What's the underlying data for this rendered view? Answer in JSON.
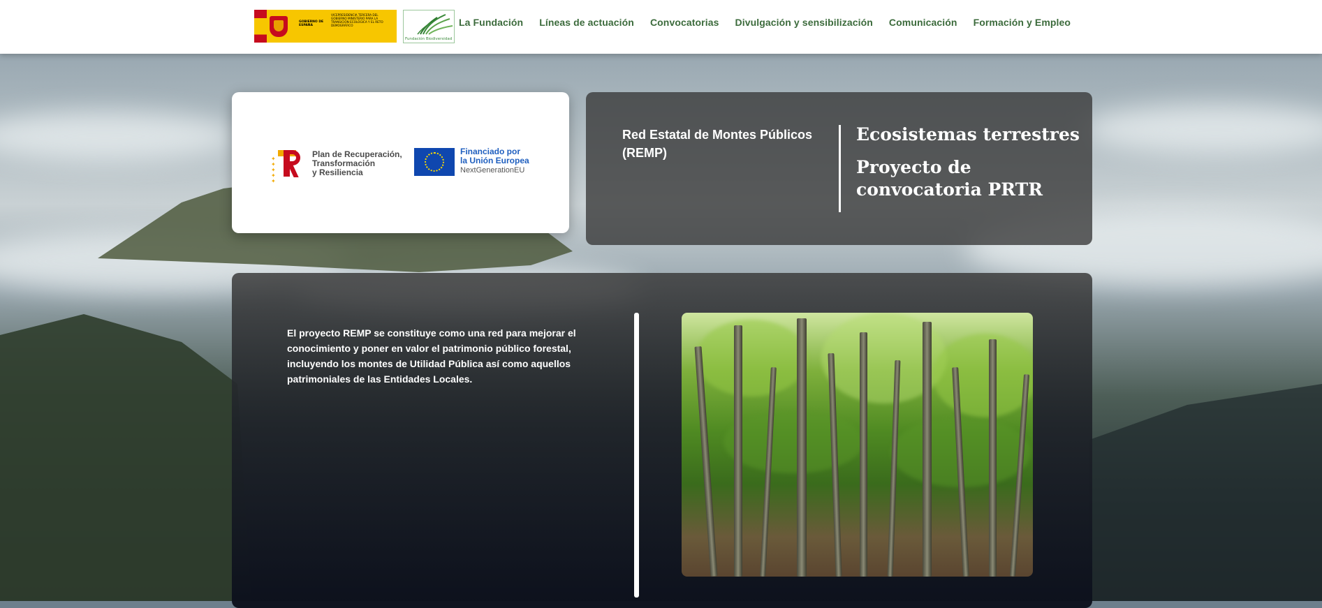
{
  "header": {
    "gov_logo": {
      "line1": "GOBIERNO DE ESPAÑA",
      "line2": "VICEPRESIDENCIA TERCERA DEL GOBIERNO MINISTERIO PARA LA TRANSICIÓN ECOLÓGICA Y EL RETO DEMOGRÁFICO"
    },
    "fb_logo_text": "Fundación Biodiversidad",
    "nav": [
      {
        "label": "La Fundación"
      },
      {
        "label": "Líneas de actuación"
      },
      {
        "label": "Convocatorias"
      },
      {
        "label": "Divulgación y sensibilización"
      },
      {
        "label": "Comunicación"
      },
      {
        "label": "Formación y Empleo"
      }
    ]
  },
  "funding": {
    "prtr": [
      "Plan de Recuperación,",
      "Transformación",
      "y Resiliencia"
    ],
    "eu": [
      "Financiado por",
      "la Unión Europea",
      "NextGenerationEU"
    ]
  },
  "title_card": {
    "project_name": "Red Estatal de Montes Públicos (REMP)",
    "category": "Ecosistemas terrestres",
    "type": "Proyecto de convocatoria PRTR"
  },
  "main": {
    "description": "El proyecto REMP se constituye como una red para mejorar el conocimiento y poner en valor el patrimonio público forestal, incluyendo los montes de Utilidad Pública así como aquellos patrimoniales de las Entidades Locales."
  },
  "colors": {
    "nav_text": "#3c6b3c",
    "eu_blue": "#0f47af",
    "prtr_red": "#c60b1e",
    "prtr_yellow": "#f2a900"
  }
}
